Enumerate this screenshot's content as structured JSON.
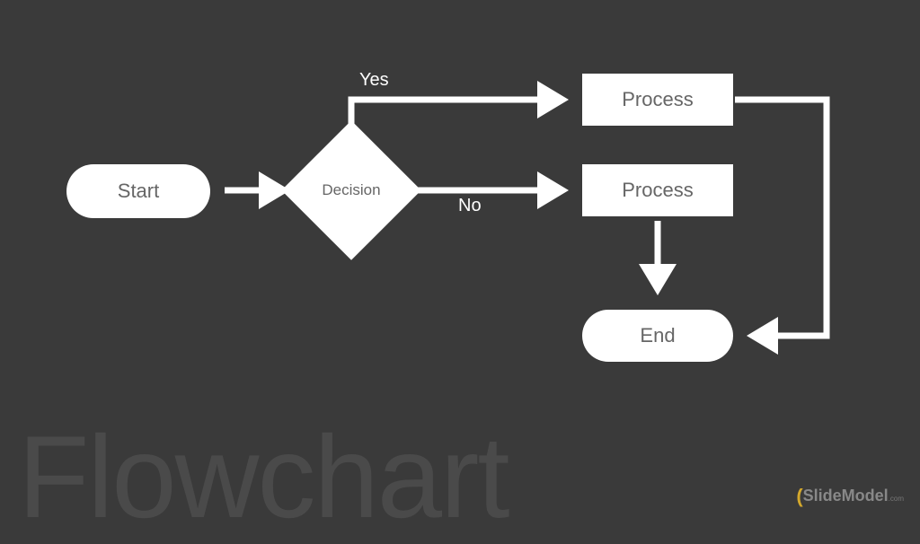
{
  "watermark": "Flowchart",
  "brand": "SlideModel",
  "brand_suffix": ".com",
  "nodes": {
    "start": "Start",
    "decision": "Decision",
    "process_yes": "Process",
    "process_no": "Process",
    "end": "End"
  },
  "edges": {
    "yes": "Yes",
    "no": "No"
  },
  "chart_data": {
    "type": "flowchart",
    "nodes": [
      {
        "id": "start",
        "type": "terminator",
        "label": "Start"
      },
      {
        "id": "decision",
        "type": "decision",
        "label": "Decision"
      },
      {
        "id": "process_yes",
        "type": "process",
        "label": "Process"
      },
      {
        "id": "process_no",
        "type": "process",
        "label": "Process"
      },
      {
        "id": "end",
        "type": "terminator",
        "label": "End"
      }
    ],
    "edges": [
      {
        "from": "start",
        "to": "decision"
      },
      {
        "from": "decision",
        "to": "process_yes",
        "label": "Yes"
      },
      {
        "from": "decision",
        "to": "process_no",
        "label": "No"
      },
      {
        "from": "process_yes",
        "to": "end"
      },
      {
        "from": "process_no",
        "to": "end"
      }
    ]
  }
}
